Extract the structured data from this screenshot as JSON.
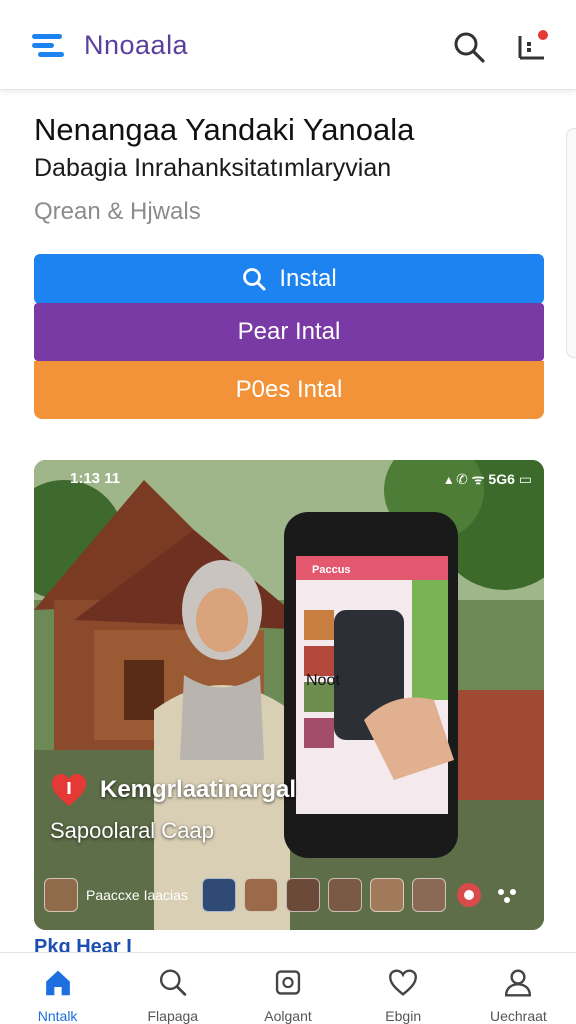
{
  "header": {
    "brand": "Nnoaala",
    "menu_icon": "hamburger-menu-icon",
    "search_icon": "search-icon",
    "notification_icon": "notification-icon",
    "accent": "#1d83f0",
    "brand_color": "#5b3f9f",
    "notification_dot_color": "#e53935"
  },
  "content": {
    "title": "Nenangaa Yandaki Yanoala",
    "subtitle": "Dabagia Inrahanksitatımlaryvian",
    "meta": "Qrean & Hjwals"
  },
  "buttons": [
    {
      "label": "Instal",
      "icon": "search-icon",
      "color": "#1d83f0"
    },
    {
      "label": "Pear Intal",
      "color": "#7a3aa6"
    },
    {
      "label": "P0es Intal",
      "color": "#f39339"
    }
  ],
  "card": {
    "status_time": "1:13 11",
    "status_icons": "▴ ✆ ᯤ 5G6 ▭",
    "person_label": "Kemgrlaatinargal",
    "subtitle": "Sapoolaral Caap",
    "thumb_label": "Paaccxe Iaacias",
    "phone_banner": "Paccus",
    "phone_label": "Noot"
  },
  "peek": {
    "text": "Pkg Hear I"
  },
  "bottom_nav": [
    {
      "label": "Nntalk",
      "icon": "home-icon",
      "active": true
    },
    {
      "label": "Flapaga",
      "icon": "search-icon",
      "active": false
    },
    {
      "label": "Aolgant",
      "icon": "square-app-icon",
      "active": false
    },
    {
      "label": "Ebgin",
      "icon": "heart-icon",
      "active": false
    },
    {
      "label": "Uechraat",
      "icon": "profile-icon",
      "active": false
    }
  ]
}
